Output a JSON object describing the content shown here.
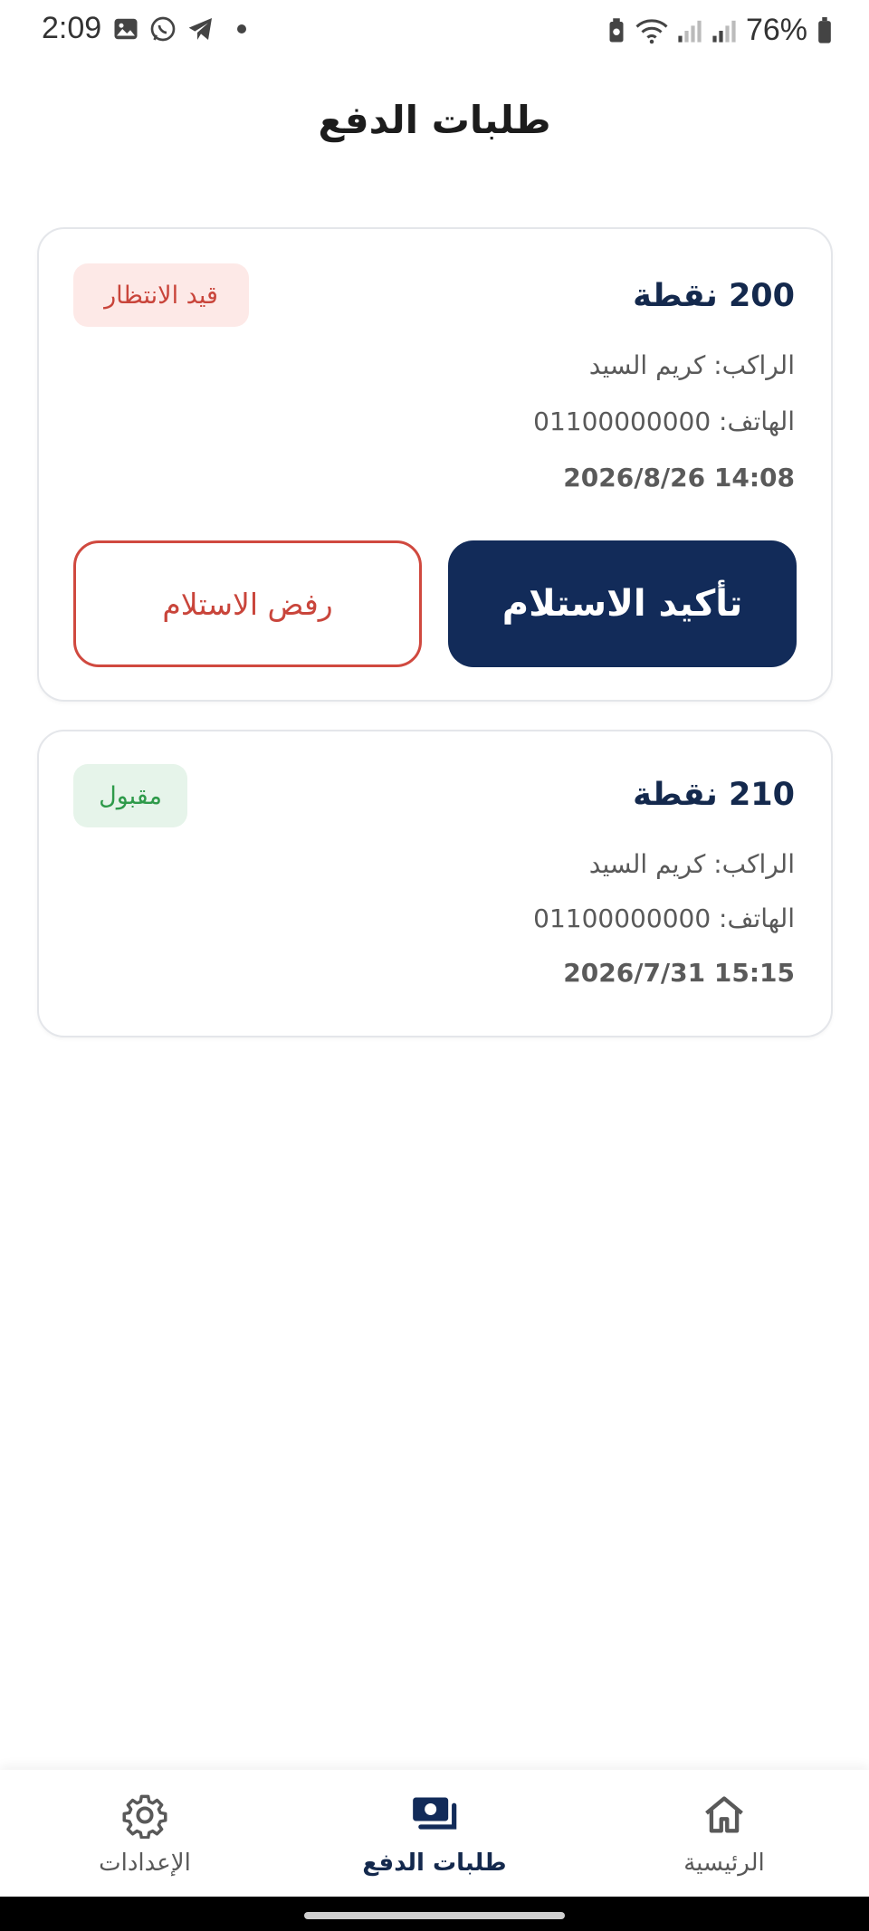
{
  "status_bar": {
    "time": "2:09",
    "battery": "76%",
    "left_icons": [
      "gallery-icon",
      "whatsapp-icon",
      "telegram-icon",
      "dot"
    ],
    "right_icons": [
      "battery-saver-icon",
      "wifi-icon",
      "signal-icon",
      "signal-icon",
      "battery-icon"
    ]
  },
  "header": {
    "title": "طلبات الدفع"
  },
  "requests": [
    {
      "amount": "200 نقطة",
      "status": "قيد الانتظار",
      "rider": "الراكب: كريم السيد",
      "phone": "الهاتف: 01100000000",
      "date": "2026/8/26 14:08",
      "confirm_label": "تأكيد الاستلام",
      "reject_label": "رفض الاستلام"
    },
    {
      "amount": "210 نقطة",
      "status": "مقبول",
      "rider": "الراكب: كريم السيد",
      "phone": "الهاتف: 01100000000",
      "date": "2026/7/31 15:15"
    }
  ],
  "bottom_nav": {
    "settings": "الإعدادات",
    "payments": "طلبات الدفع",
    "home": "الرئيسية",
    "active": "payments"
  },
  "colors": {
    "primary": "#122b59",
    "pending_bg": "#fde9e7",
    "pending_text": "#c9453b",
    "accepted_bg": "#e6f4ea",
    "accepted_text": "#2e9a4a"
  }
}
